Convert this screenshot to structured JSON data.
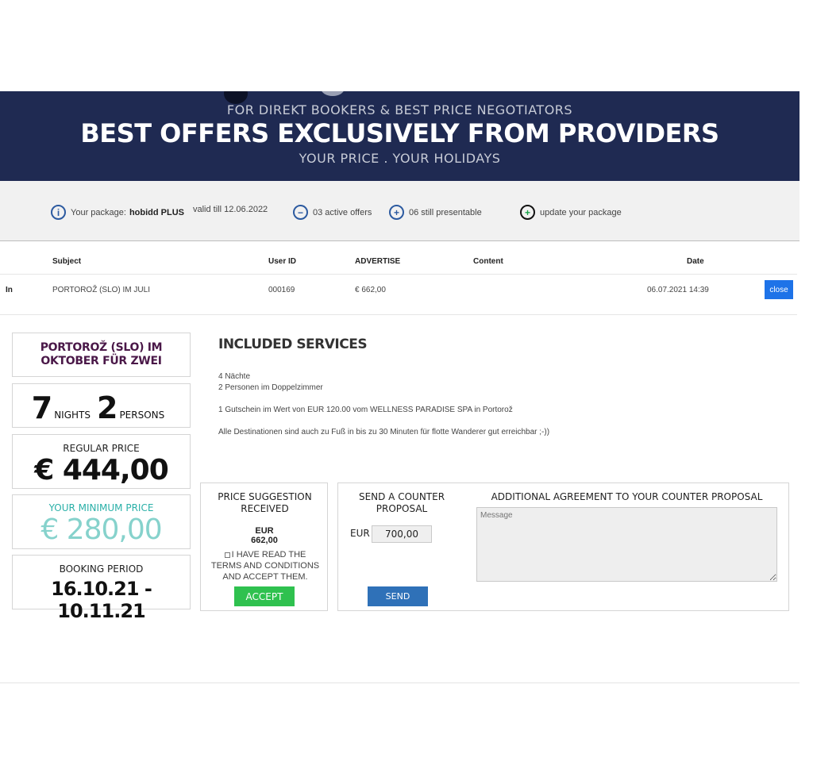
{
  "hero": {
    "subtitle": "FOR DIREKT BOOKERS & BEST PRICE NEGOTIATORS",
    "title": "BEST OFFERS EXCLUSIVELY FROM PROVIDERS",
    "tagline": "YOUR PRICE . YOUR HOLIDAYS",
    "bg_color": "#1f2a52"
  },
  "infobar": {
    "package_label": "Your package:",
    "package_name": "hobidd PLUS",
    "valid": "valid till 12.06.2022",
    "active_offers": "03 active offers",
    "still_presentable": "06 still presentable",
    "update": "update your package",
    "icons": {
      "info": "info-icon",
      "minus": "minus-circle-icon",
      "plus": "plus-circle-icon",
      "update": "update-plus-icon"
    }
  },
  "table": {
    "headers": [
      "Subject",
      "User ID",
      "ADVERTISE",
      "Content",
      "Date"
    ],
    "row": {
      "direction": "In",
      "subject": "PORTOROŽ (SLO) IM JULI",
      "user_id": "000169",
      "advertise": "€ 662,00",
      "content": "",
      "date": "06.07.2021 14:39",
      "close_label": "close"
    }
  },
  "offer": {
    "title_line1": "PORTOROŽ (SLO) IM",
    "title_line2": "OKTOBER FÜR ZWEI",
    "nights": "7",
    "nights_label": "NIGHTS",
    "persons": "2",
    "persons_label": "PERSONS",
    "regular_label": "REGULAR PRICE",
    "regular_price": "€ 444,00",
    "min_label": "YOUR MINIMUM PRICE",
    "min_price": "€ 280,00",
    "period_label": "BOOKING PERIOD",
    "period": "16.10.21 - 10.11.21"
  },
  "services": {
    "title": "INCLUDED SERVICES",
    "lines": [
      "4 Nächte",
      "2 Personen im Doppelzimmer",
      "1 Gutschein im Wert von EUR 120.00 vom WELLNESS PARADISE SPA in Portorož",
      "Alle Destinationen sind auch zu Fuß in bis zu 30 Minuten für flotte Wanderer gut erreichbar ;-))"
    ]
  },
  "suggestion": {
    "title_line1": "PRICE SUGGESTION",
    "title_line2": "RECEIVED",
    "amount": "EUR 662,00",
    "terms": "I HAVE READ THE TERMS AND CONDITIONS AND ACCEPT THEM.",
    "accept_label": "ACCEPT",
    "accept_color": "#2fc14f"
  },
  "counter": {
    "title_line1": "SEND A COUNTER",
    "title_line2": "PROPOSAL",
    "currency": "EUR",
    "value": "700,00",
    "send_label": "SEND",
    "agreement_title": "ADDITIONAL AGREEMENT TO YOUR COUNTER PROPOSAL",
    "message_placeholder": "Message",
    "send_color": "#2f71b8"
  }
}
